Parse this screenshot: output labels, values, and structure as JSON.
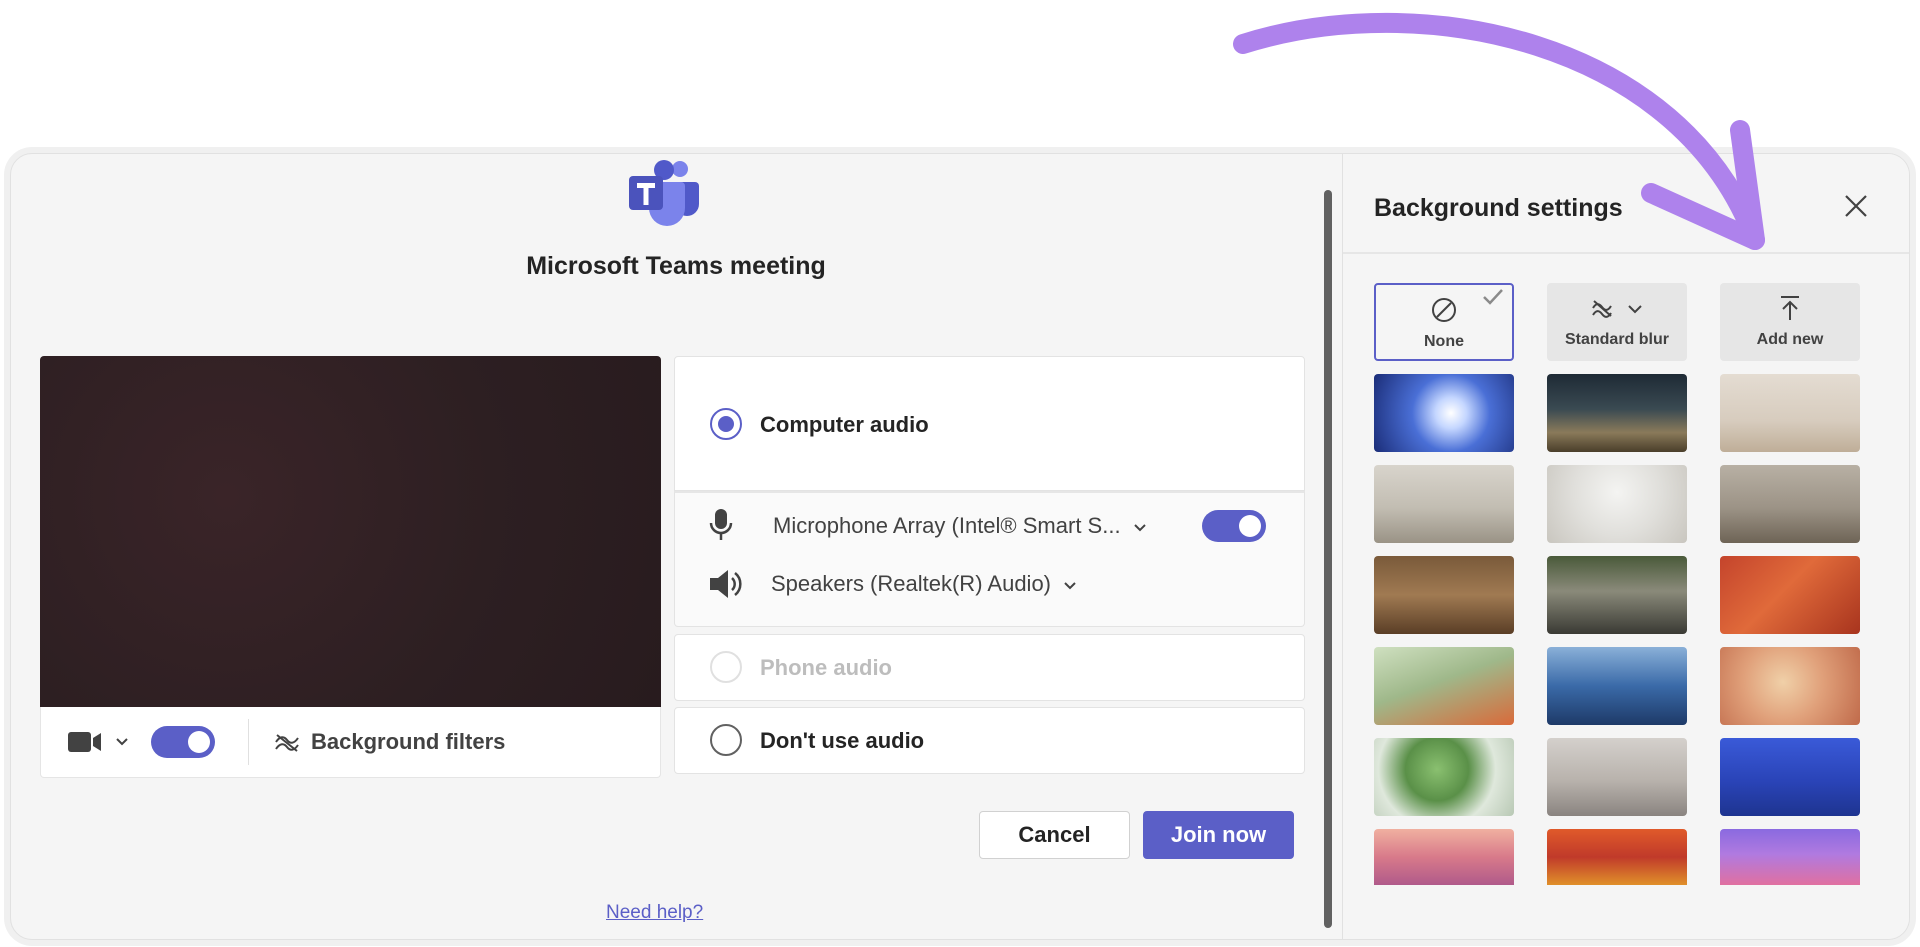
{
  "meeting": {
    "title": "Microsoft Teams meeting"
  },
  "video": {
    "background_filters_label": "Background filters"
  },
  "audio": {
    "computer_audio": "Computer audio",
    "microphone": "Microphone Array (Intel® Smart S...",
    "speakers": "Speakers (Realtek(R) Audio)",
    "phone_audio": "Phone audio",
    "dont_use_audio": "Don't use audio"
  },
  "actions": {
    "cancel": "Cancel",
    "join_now": "Join now",
    "need_help": "Need help?"
  },
  "background_settings": {
    "title": "Background settings",
    "options": {
      "none": "None",
      "standard_blur": "Standard blur",
      "add_new": "Add new"
    },
    "selected": "None"
  },
  "colors": {
    "accent": "#5b5fc7",
    "annotation_arrow": "#ae82ec"
  }
}
